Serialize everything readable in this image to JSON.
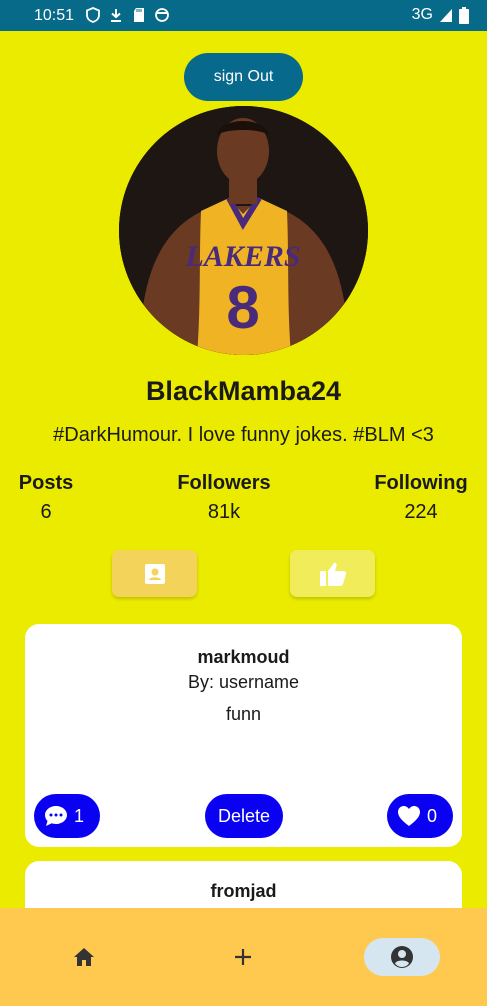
{
  "status_bar": {
    "time": "10:51",
    "network": "3G"
  },
  "header": {
    "sign_out_label": "sign Out"
  },
  "profile": {
    "username": "BlackMamba24",
    "bio": "#DarkHumour. I love funny jokes. #BLM <3"
  },
  "stats": {
    "posts": {
      "label": "Posts",
      "value": "6"
    },
    "followers": {
      "label": "Followers",
      "value": "81k"
    },
    "following": {
      "label": "Following",
      "value": "224"
    }
  },
  "tabs": {
    "posts_icon": "contact-card-icon",
    "likes_icon": "thumbs-up-icon"
  },
  "posts": [
    {
      "title": "markmoud",
      "author": "By: username",
      "body": "funn",
      "comment_count": "1",
      "delete_label": "Delete",
      "like_count": "0"
    },
    {
      "title": "fromjad"
    }
  ],
  "bottom_nav": {
    "items": [
      "home-icon",
      "add-icon",
      "account-icon"
    ],
    "active": "account-icon"
  },
  "colors": {
    "background": "#ebeb00",
    "status_bar": "#076a88",
    "action_pill": "#0a00f2",
    "bottom_nav": "#ffc94f"
  }
}
